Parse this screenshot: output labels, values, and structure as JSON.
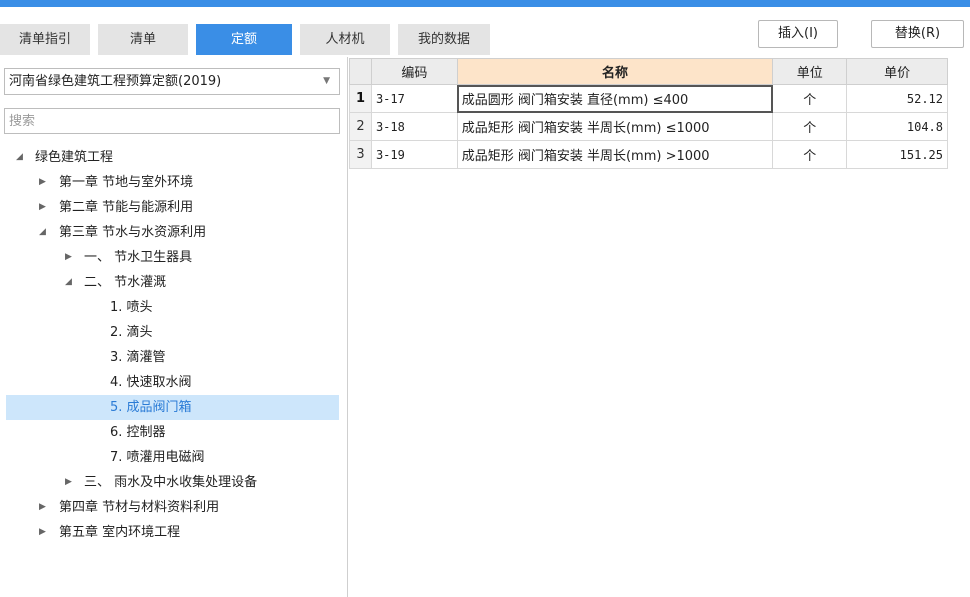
{
  "tabs": [
    {
      "label": "清单指引"
    },
    {
      "label": "清单"
    },
    {
      "label": "定额",
      "active": true
    },
    {
      "label": "人材机"
    },
    {
      "label": "我的数据"
    }
  ],
  "buttons": {
    "insert": "插入(I)",
    "replace": "替换(R)"
  },
  "quota_select": {
    "value": "河南省绿色建筑工程预算定额(2019)"
  },
  "search": {
    "placeholder": "搜索"
  },
  "tree": [
    {
      "label": "绿色建筑工程",
      "expanded": true
    },
    {
      "label": "第一章 节地与室外环境",
      "expanded": false
    },
    {
      "label": "第二章 节能与能源利用",
      "expanded": false
    },
    {
      "label": "第三章 节水与水资源利用",
      "expanded": true
    },
    {
      "label": "一、 节水卫生器具",
      "expanded": false
    },
    {
      "label": "二、 节水灌溉",
      "expanded": true
    },
    {
      "label": "1. 喷头"
    },
    {
      "label": "2. 滴头"
    },
    {
      "label": "3. 滴灌管"
    },
    {
      "label": "4. 快速取水阀"
    },
    {
      "label": "5. 成品阀门箱",
      "selected": true
    },
    {
      "label": "6. 控制器"
    },
    {
      "label": "7. 喷灌用电磁阀"
    },
    {
      "label": "三、 雨水及中水收集处理设备",
      "expanded": false
    },
    {
      "label": "第四章 节材与材料资料利用",
      "expanded": false
    },
    {
      "label": "第五章 室内环境工程",
      "expanded": false
    }
  ],
  "table": {
    "headers": {
      "code": "编码",
      "name": "名称",
      "unit": "单位",
      "price": "单价"
    },
    "rows": [
      {
        "num": "1",
        "code": "3-17",
        "name": "成品圆形 阀门箱安装 直径(mm) ≤400",
        "unit": "个",
        "price": "52.12"
      },
      {
        "num": "2",
        "code": "3-18",
        "name": "成品矩形 阀门箱安装 半周长(mm) ≤1000",
        "unit": "个",
        "price": "104.8"
      },
      {
        "num": "3",
        "code": "3-19",
        "name": "成品矩形 阀门箱安装 半周长(mm) >1000",
        "unit": "个",
        "price": "151.25"
      }
    ]
  },
  "colors": {
    "accent": "#3a8ee6",
    "selected_row": "#cde6fb",
    "name_header": "#fde4c9"
  },
  "icons": {
    "expanded": "triangle-down-icon",
    "collapsed": "triangle-right-icon",
    "dropdown": "chevron-down-icon"
  }
}
